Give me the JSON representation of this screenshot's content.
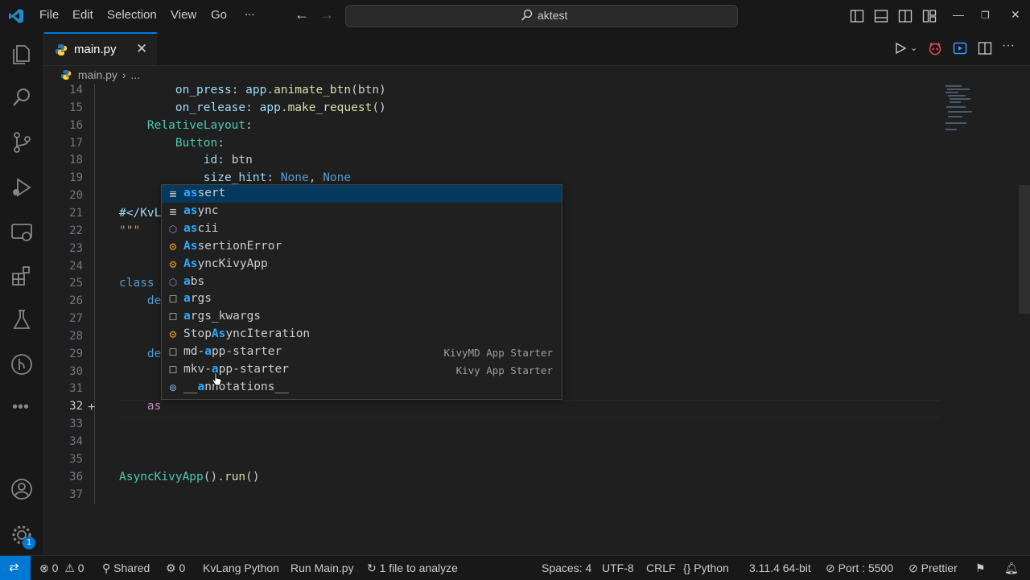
{
  "menu": [
    "File",
    "Edit",
    "Selection",
    "View",
    "Go",
    "..."
  ],
  "search": {
    "text": "aktest"
  },
  "tab": {
    "label": "main.py",
    "close": "✕"
  },
  "breadcrumb": {
    "file": "main.py",
    "rest": "..."
  },
  "lines": [
    {
      "n": "14",
      "code": [
        [
          "        ",
          "k-light"
        ],
        [
          "on_press",
          "k-light"
        ],
        [
          ": ",
          ""
        ],
        [
          "app",
          "k-light"
        ],
        [
          ".",
          ""
        ],
        [
          "animate_btn",
          "k-yel"
        ],
        [
          "(btn)",
          ""
        ]
      ]
    },
    {
      "n": "15",
      "code": [
        [
          "        ",
          ""
        ],
        [
          "on_release",
          "k-light"
        ],
        [
          ": ",
          ""
        ],
        [
          "app",
          "k-light"
        ],
        [
          ".",
          ""
        ],
        [
          "make_request",
          "k-yel"
        ],
        [
          "()",
          ""
        ]
      ]
    },
    {
      "n": "16",
      "code": [
        [
          "    ",
          ""
        ],
        [
          "RelativeLayout",
          "k-cyan"
        ],
        [
          ":",
          ""
        ]
      ]
    },
    {
      "n": "17",
      "code": [
        [
          "        ",
          ""
        ],
        [
          "Button",
          "k-cyan"
        ],
        [
          ":",
          ""
        ]
      ]
    },
    {
      "n": "18",
      "code": [
        [
          "            ",
          ""
        ],
        [
          "id",
          "k-light"
        ],
        [
          ": btn",
          ""
        ]
      ]
    },
    {
      "n": "19",
      "code": [
        [
          "            ",
          ""
        ],
        [
          "size_hint",
          "k-light"
        ],
        [
          ": ",
          ""
        ],
        [
          "None",
          "k-blue"
        ],
        [
          ", ",
          ""
        ],
        [
          "None",
          "k-blue"
        ]
      ]
    },
    {
      "n": "20",
      "code": []
    },
    {
      "n": "21",
      "code": [
        [
          "#</KvL",
          "k-light"
        ]
      ]
    },
    {
      "n": "22",
      "code": [
        [
          "\"\"\"",
          "k-str"
        ]
      ]
    },
    {
      "n": "23",
      "code": []
    },
    {
      "n": "24",
      "code": []
    },
    {
      "n": "25",
      "code": [
        [
          "class",
          "k-blue"
        ]
      ]
    },
    {
      "n": "26",
      "code": [
        [
          "    ",
          ""
        ],
        [
          "de",
          "k-blue"
        ]
      ]
    },
    {
      "n": "27",
      "code": []
    },
    {
      "n": "28",
      "code": []
    },
    {
      "n": "29",
      "code": [
        [
          "    ",
          ""
        ],
        [
          "de",
          "k-blue"
        ]
      ]
    },
    {
      "n": "30",
      "code": []
    },
    {
      "n": "31",
      "code": []
    },
    {
      "n": "32",
      "code": [
        [
          "    ",
          ""
        ],
        [
          "as",
          "k-pink"
        ]
      ]
    },
    {
      "n": "33",
      "code": []
    },
    {
      "n": "34",
      "code": []
    },
    {
      "n": "35",
      "code": []
    },
    {
      "n": "36",
      "code": [
        [
          "AsyncKivyApp",
          "k-cyan"
        ],
        [
          "().",
          ""
        ],
        [
          "run",
          "k-yel"
        ],
        [
          "()",
          ""
        ]
      ]
    },
    {
      "n": "37",
      "code": []
    }
  ],
  "suggestions": [
    {
      "icon": "keyword-icon",
      "glyph": "≣",
      "color": "#cccccc",
      "hl": "as",
      "rest": "sert",
      "detail": "",
      "selected": true
    },
    {
      "icon": "keyword-icon",
      "glyph": "≣",
      "color": "#cccccc",
      "hl": "as",
      "rest": "ync",
      "detail": ""
    },
    {
      "icon": "function-icon",
      "glyph": "⬡",
      "color": "#b180d7",
      "hl": "as",
      "rest": "cii",
      "detail": ""
    },
    {
      "icon": "class-icon",
      "glyph": "⚙",
      "color": "#ee9d28",
      "hl": "As",
      "rest": "sertionError",
      "detail": ""
    },
    {
      "icon": "class-icon",
      "glyph": "⚙",
      "color": "#ee9d28",
      "hl": "As",
      "rest": "yncKivyApp",
      "detail": ""
    },
    {
      "icon": "function-icon",
      "glyph": "⬡",
      "color": "#b180d7",
      "hl": "a",
      "rest": "bs",
      "detail": ""
    },
    {
      "icon": "snippet-icon",
      "glyph": "☐",
      "color": "#cccccc",
      "hl": "a",
      "rest": "rgs",
      "detail": ""
    },
    {
      "icon": "snippet-icon",
      "glyph": "☐",
      "color": "#cccccc",
      "hl": "a",
      "rest": "rgs_kwargs",
      "detail": ""
    },
    {
      "icon": "class-icon",
      "glyph": "⚙",
      "color": "#ee9d28",
      "pre": "Stop",
      "hl": "As",
      "rest": "yncIteration",
      "detail": ""
    },
    {
      "icon": "snippet-icon",
      "glyph": "☐",
      "color": "#cccccc",
      "pre": "md-",
      "hl": "a",
      "rest": "pp-starter",
      "detail": "KivyMD App Starter"
    },
    {
      "icon": "snippet-icon",
      "glyph": "☐",
      "color": "#cccccc",
      "pre": "mkv-",
      "hl": "a",
      "rest": "pp-starter",
      "detail": "Kivy App Starter"
    },
    {
      "icon": "variable-icon",
      "glyph": "⊚",
      "color": "#75beff",
      "pre": "__",
      "hl": "a",
      "rest": "nnotations__",
      "detail": ""
    }
  ],
  "status": {
    "errors": "0",
    "warnings": "0",
    "shared": "Shared",
    "ports": "0",
    "kvlang": "KvLang Python",
    "run": "Run Main.py",
    "analyze": "1 file to analyze",
    "spaces": "Spaces: 4",
    "encoding": "UTF-8",
    "eol": "CRLF",
    "language": "Python",
    "version": "3.11.4 64-bit",
    "port": "Port : 5500",
    "prettier": "Prettier"
  },
  "settings_badge": "1",
  "colors": {
    "accent": "#0078d4",
    "highlight": "#2aaaff"
  }
}
